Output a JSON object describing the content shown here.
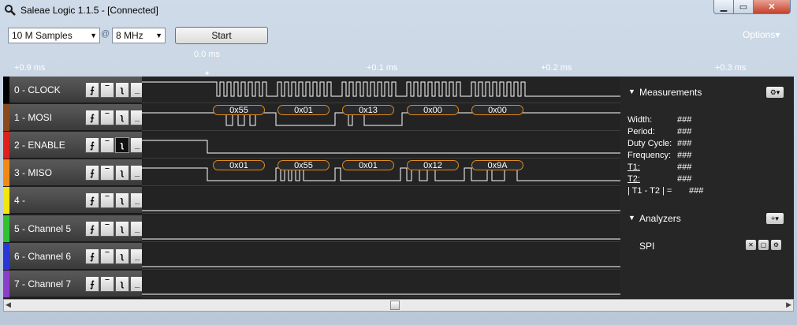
{
  "window": {
    "title": "Saleae Logic 1.1.5 - [Connected]"
  },
  "toolbar": {
    "samples_value": "10 M Samples",
    "at_sign": "@",
    "rate_value": "8 MHz",
    "start_label": "Start",
    "options_label": "Options▾"
  },
  "ruler": {
    "origin_label": "0.0 ms",
    "ticks": [
      "+0.9 ms",
      "+0.1 ms",
      "+0.2 ms",
      "+0.3 ms"
    ]
  },
  "channels": [
    {
      "name": "0 - CLOCK",
      "color": "#000000"
    },
    {
      "name": "1 - MOSI",
      "color": "#8b4a1c"
    },
    {
      "name": "2 - ENABLE",
      "color": "#e0201b"
    },
    {
      "name": "3 - MISO",
      "color": "#f08a17"
    },
    {
      "name": "4 -",
      "color": "#f2e60c"
    },
    {
      "name": "5 - Channel 5",
      "color": "#31c231"
    },
    {
      "name": "6 - Channel 6",
      "color": "#2a36d6"
    },
    {
      "name": "7 - Channel 7",
      "color": "#8a3fc8"
    }
  ],
  "decodes": {
    "mosi": [
      "0x55",
      "0x01",
      "0x13",
      "0x00",
      "0x00"
    ],
    "miso": [
      "0x01",
      "0x55",
      "0x01",
      "0x12",
      "0x9A"
    ]
  },
  "measurements": {
    "title": "Measurements",
    "rows": [
      {
        "label": "Width:",
        "value": "###"
      },
      {
        "label": "Period:",
        "value": "###"
      },
      {
        "label": "Duty Cycle:",
        "value": "###"
      },
      {
        "label": "Frequency:",
        "value": "###"
      },
      {
        "label": "T1:",
        "value": "###"
      },
      {
        "label": "T2:",
        "value": "###"
      },
      {
        "label": "| T1 - T2 | =",
        "value": "###"
      }
    ]
  },
  "analyzers": {
    "title": "Analyzers",
    "items": [
      {
        "label": "SPI"
      }
    ]
  }
}
